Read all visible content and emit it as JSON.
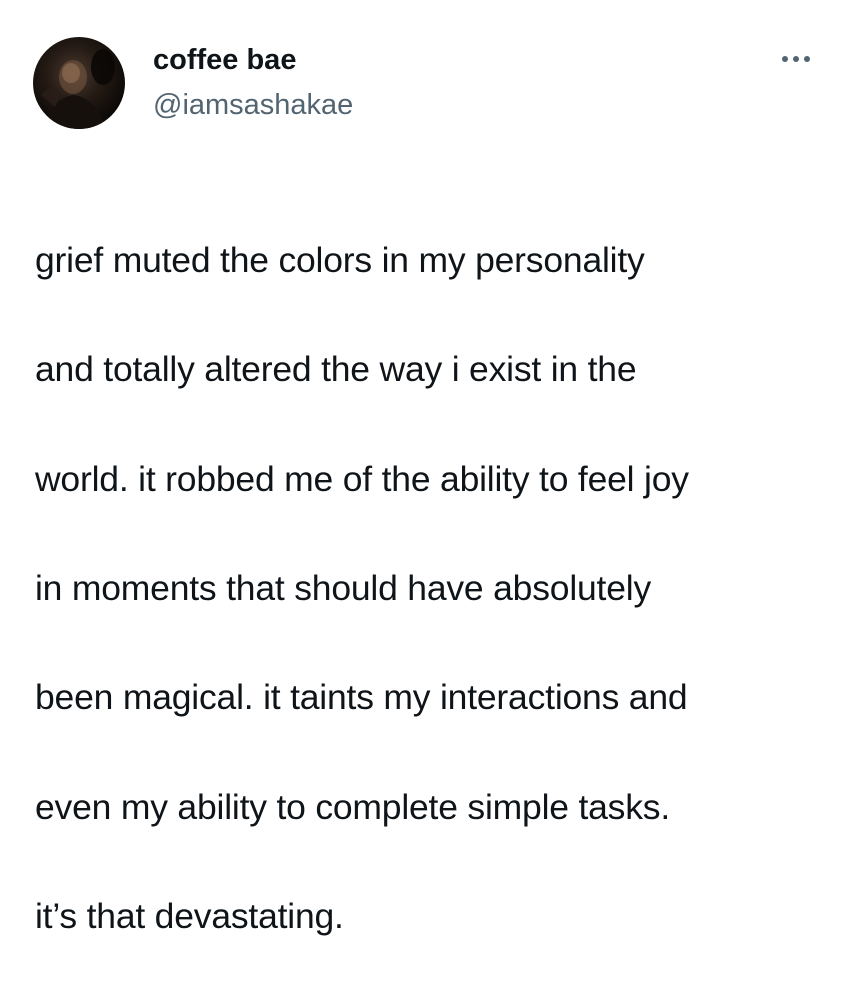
{
  "tweet": {
    "author": {
      "display_name": "coffee bae",
      "handle": "@iamsashakae",
      "avatar_icon": "profile-photo"
    },
    "more_icon": "more-horizontal-icon",
    "text_lines": [
      "grief muted the colors in my personality",
      "and totally altered the way i exist in the",
      "world. it robbed me of the ability to feel joy",
      "in moments that should have absolutely",
      "been magical. it taints my interactions and",
      "even my ability to complete simple tasks.",
      "it’s that devastating."
    ]
  },
  "colors": {
    "text": "#0f1419",
    "secondary_text": "#536471",
    "background": "#ffffff"
  }
}
